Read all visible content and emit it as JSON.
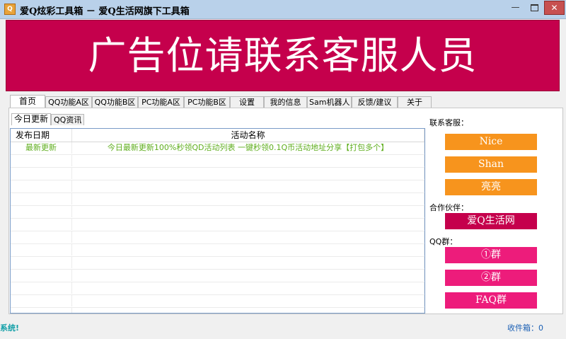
{
  "window": {
    "title": "爱Q炫彩工具箱 － 爱Q生活网旗下工具箱",
    "icon_label": "Q",
    "minimize_icon": "minimize-icon",
    "maximize_icon": "maximize-icon",
    "close_icon": "close-icon",
    "minimize_glyph": "—",
    "close_glyph": "✕"
  },
  "banner": {
    "text": "广告位请联系客服人员",
    "background": "#c5004c"
  },
  "tabs": [
    {
      "label": "首页",
      "active": true
    },
    {
      "label": "QQ功能A区"
    },
    {
      "label": "QQ功能B区"
    },
    {
      "label": "PC功能A区"
    },
    {
      "label": "PC功能B区"
    },
    {
      "label": "设置"
    },
    {
      "label": "我的信息"
    },
    {
      "label": "Sam机器人"
    },
    {
      "label": "反馈/建议"
    },
    {
      "label": "关于"
    }
  ],
  "subtabs": [
    {
      "label": "今日更新",
      "active": true
    },
    {
      "label": "QQ资讯"
    }
  ],
  "list": {
    "columns": [
      "发布日期",
      "活动名称"
    ],
    "rows": [
      {
        "date": "最新更新",
        "name": "今日最新更新100%秒领QD活动列表 一键秒领0.1Q币活动地址分享【打包多个】"
      }
    ],
    "row_color": "#5fae1e"
  },
  "sidebar": {
    "service_label": "联系客服：",
    "service_buttons": [
      "Nice",
      "Shan",
      "亮亮"
    ],
    "partner_label": "合作伙伴：",
    "partner_button": "爱Q生活网",
    "group_label": "QQ群：",
    "group_buttons": [
      "①群",
      "②群",
      "FAQ群"
    ],
    "colors": {
      "service": "#f7941d",
      "partner": "#c5004c",
      "group": "#ed1c7b"
    }
  },
  "status": {
    "left": "系统!",
    "right": "收件箱：0"
  }
}
